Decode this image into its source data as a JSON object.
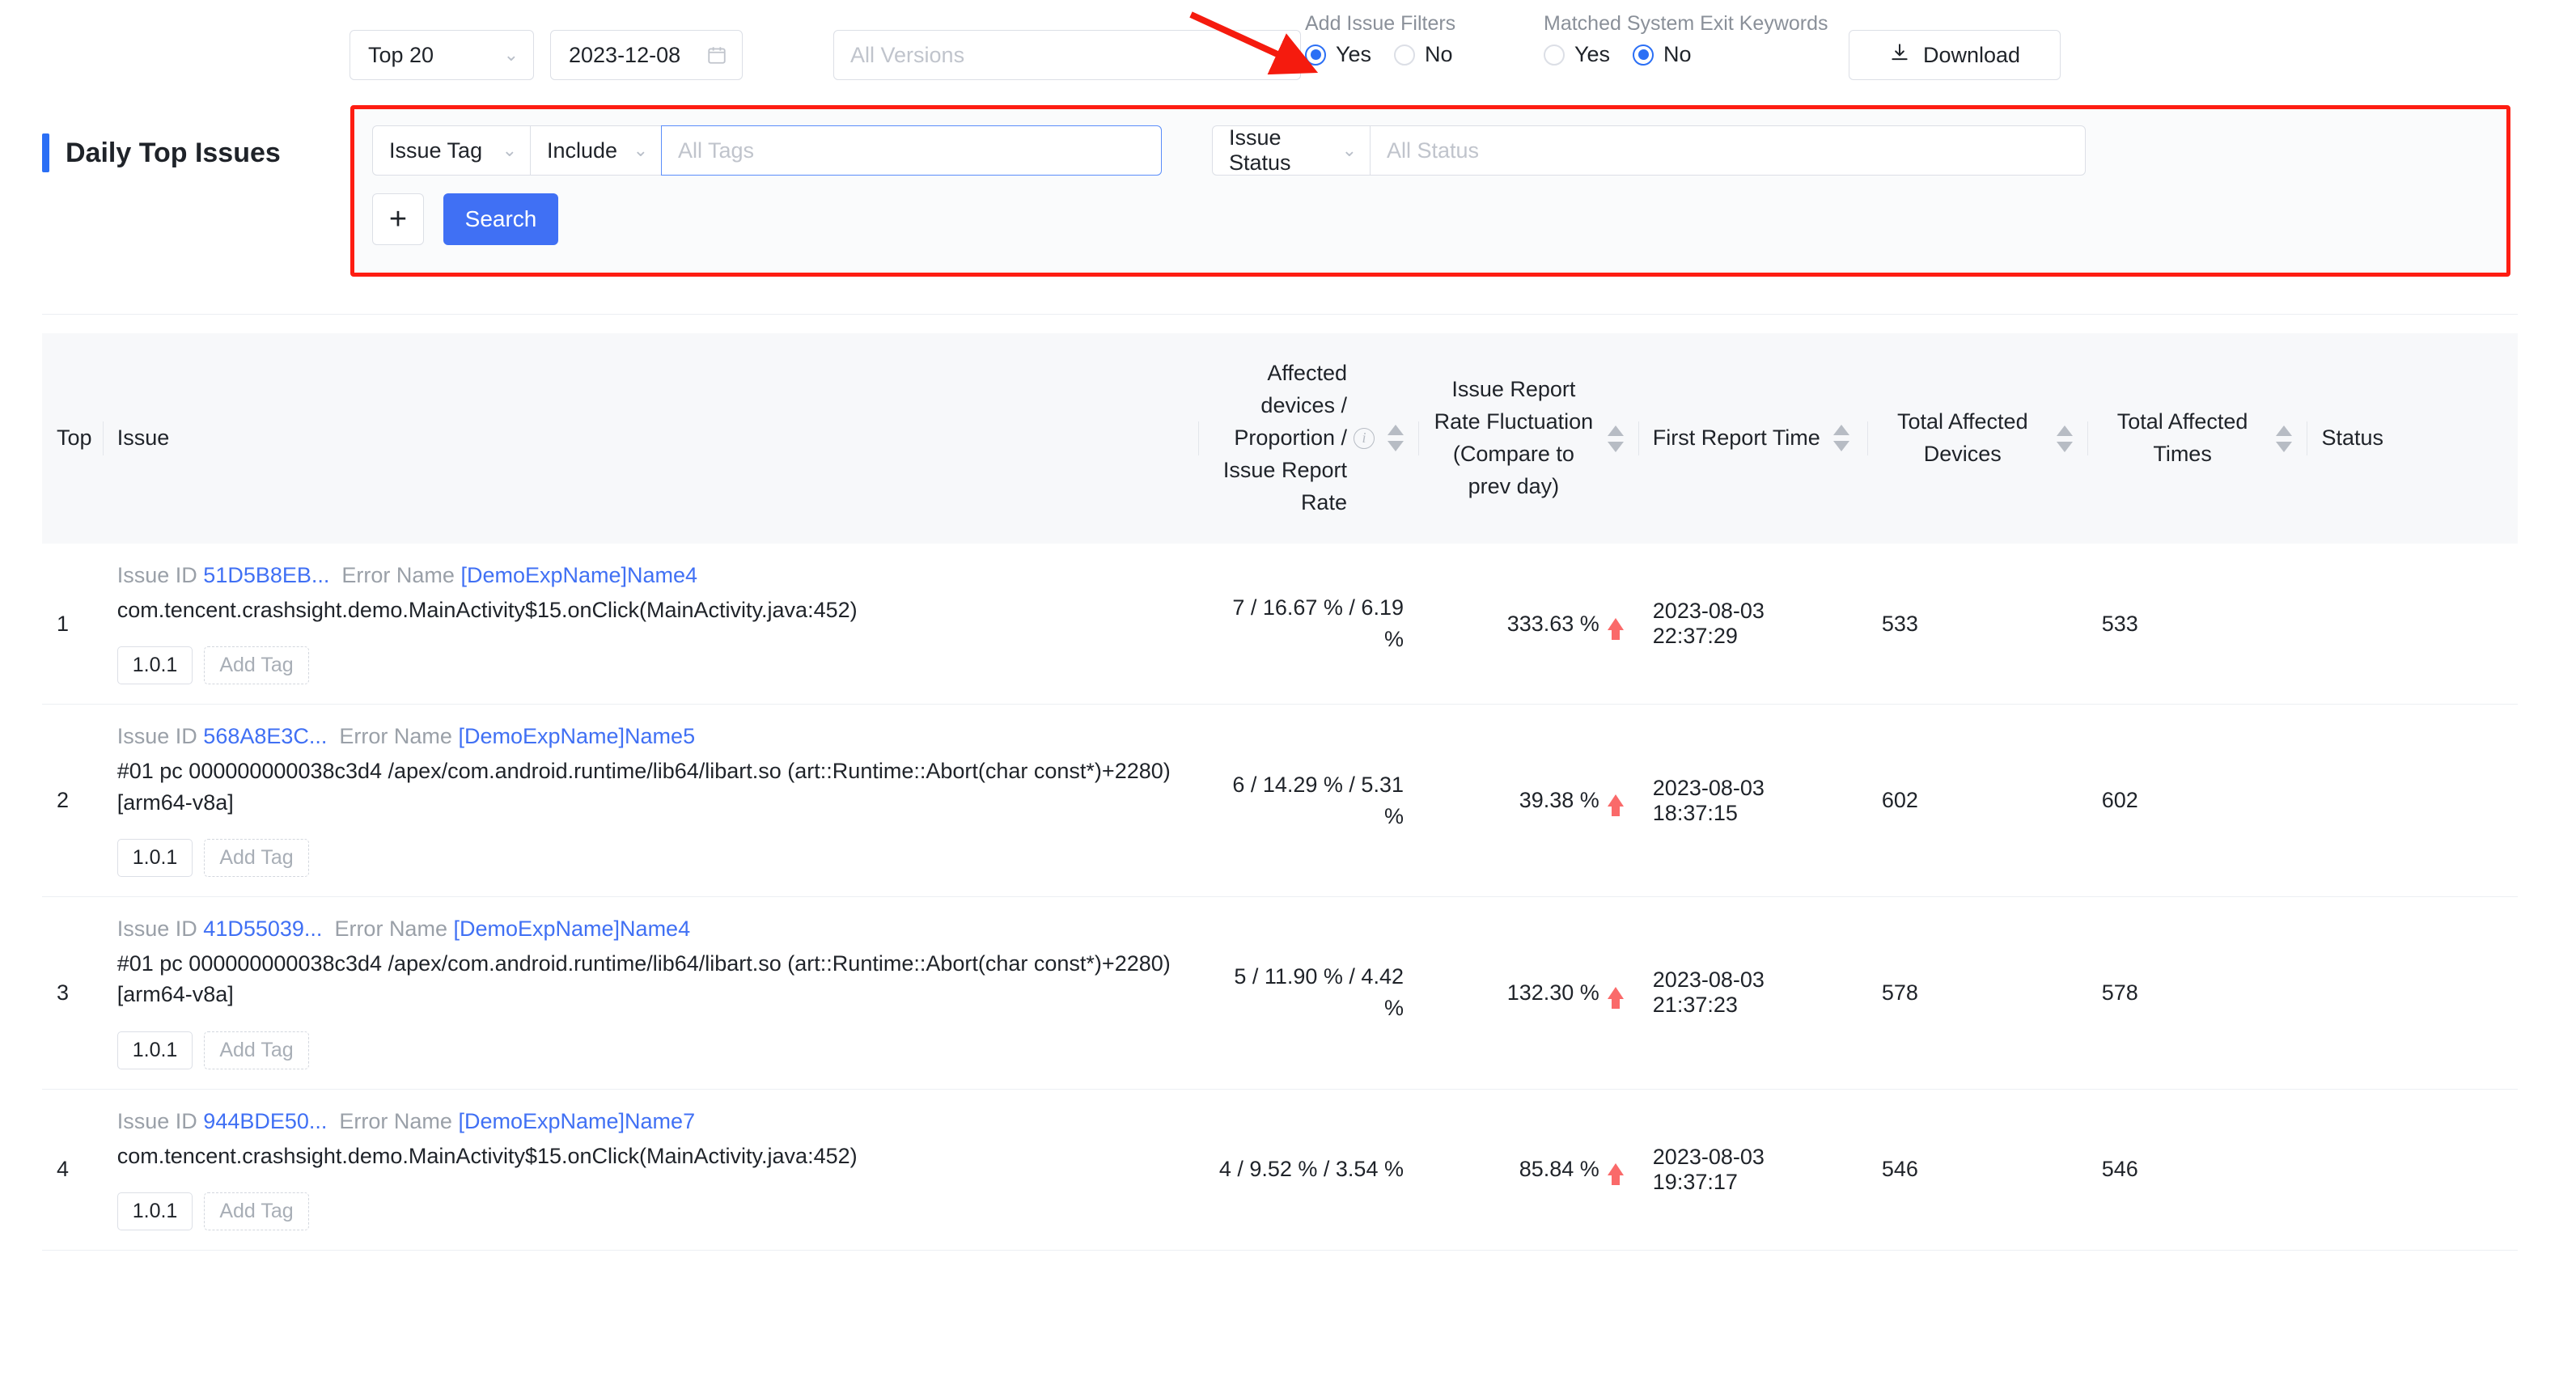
{
  "topbar": {
    "top_select": "Top 20",
    "date_value": "2023-12-08",
    "versions_placeholder": "All Versions",
    "add_issue_filters": {
      "label": "Add Issue Filters",
      "yes": "Yes",
      "no": "No",
      "selected": "Yes"
    },
    "matched_keywords": {
      "label": "Matched System Exit Keywords",
      "yes": "Yes",
      "no": "No",
      "selected": "No"
    },
    "download_label": "Download",
    "download_icon": "download-icon"
  },
  "page_title": "Daily Top Issues",
  "filters": {
    "field_select": "Issue Tag",
    "operator_select": "Include",
    "tags_placeholder": "All Tags",
    "status_select": "Issue Status",
    "status_placeholder": "All Status",
    "add_button": "+",
    "search_button": "Search",
    "highlight_color": "#fe1d12"
  },
  "table": {
    "headers": {
      "top": "Top",
      "issue": "Issue",
      "affected": "Affected devices / Proportion / Issue Report Rate",
      "fluctuation": "Issue Report Rate Fluctuation (Compare to prev day)",
      "first_report": "First Report Time",
      "total_devices": "Total Affected Devices",
      "total_times": "Total Affected Times",
      "status": "Status"
    },
    "rows": [
      {
        "top": "1",
        "issue_id_label": "Issue ID",
        "issue_id": "51D5B8EB...",
        "error_name_label": "Error Name",
        "error_name": "[DemoExpName]Name4",
        "stack": "com.tencent.crashsight.demo.MainActivity$15.onClick(MainActivity.java:452)",
        "version_tag": "1.0.1",
        "add_tag": "Add Tag",
        "affected": "7 / 16.67 % / 6.19 %",
        "fluctuation": "333.63 %",
        "fluctuation_dir": "up",
        "first_report": "2023-08-03 22:37:29",
        "total_devices": "533",
        "total_times": "533",
        "status": ""
      },
      {
        "top": "2",
        "issue_id_label": "Issue ID",
        "issue_id": "568A8E3C...",
        "error_name_label": "Error Name",
        "error_name": "[DemoExpName]Name5",
        "stack": "#01   pc 000000000038c3d4    /apex/com.android.runtime/lib64/libart.so (art::Runtime::Abort(char const*)+2280) [arm64-v8a]",
        "version_tag": "1.0.1",
        "add_tag": "Add Tag",
        "affected": "6 / 14.29 % / 5.31 %",
        "fluctuation": "39.38 %",
        "fluctuation_dir": "up",
        "first_report": "2023-08-03 18:37:15",
        "total_devices": "602",
        "total_times": "602",
        "status": ""
      },
      {
        "top": "3",
        "issue_id_label": "Issue ID",
        "issue_id": "41D55039...",
        "error_name_label": "Error Name",
        "error_name": "[DemoExpName]Name4",
        "stack": "#01   pc 000000000038c3d4    /apex/com.android.runtime/lib64/libart.so (art::Runtime::Abort(char const*)+2280) [arm64-v8a]",
        "version_tag": "1.0.1",
        "add_tag": "Add Tag",
        "affected": "5 / 11.90 % / 4.42 %",
        "fluctuation": "132.30 %",
        "fluctuation_dir": "up",
        "first_report": "2023-08-03 21:37:23",
        "total_devices": "578",
        "total_times": "578",
        "status": ""
      },
      {
        "top": "4",
        "issue_id_label": "Issue ID",
        "issue_id": "944BDE50...",
        "error_name_label": "Error Name",
        "error_name": "[DemoExpName]Name7",
        "stack": "com.tencent.crashsight.demo.MainActivity$15.onClick(MainActivity.java:452)",
        "version_tag": "1.0.1",
        "add_tag": "Add Tag",
        "affected": "4 / 9.52 % / 3.54 %",
        "fluctuation": "85.84 %",
        "fluctuation_dir": "up",
        "first_report": "2023-08-03 19:37:17",
        "total_devices": "546",
        "total_times": "546",
        "status": ""
      }
    ]
  }
}
